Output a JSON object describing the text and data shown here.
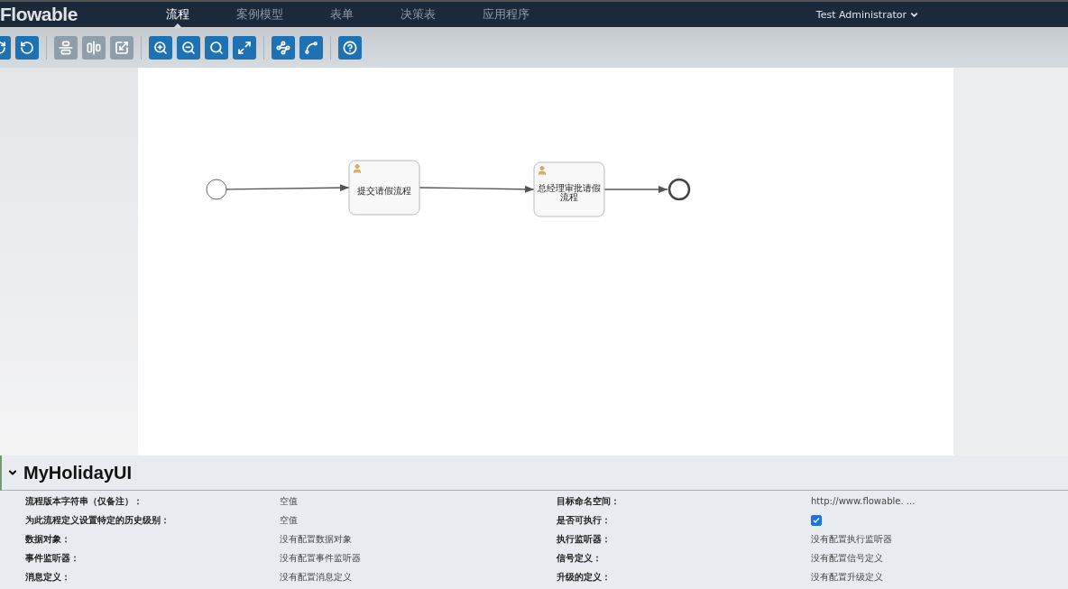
{
  "navbar": {
    "logo": "Flowable",
    "tabs": [
      {
        "label": "流程",
        "selected": true
      },
      {
        "label": "案例模型",
        "selected": false
      },
      {
        "label": "表单",
        "selected": false
      },
      {
        "label": "决策表",
        "selected": false
      },
      {
        "label": "应用程序",
        "selected": false
      }
    ],
    "user": "Test Administrator"
  },
  "toolbar": {
    "groups": [
      [
        {
          "kind": "redo",
          "disabled": false
        },
        {
          "kind": "undo",
          "disabled": false
        }
      ],
      [
        {
          "kind": "align_horizontal",
          "disabled": true
        },
        {
          "kind": "align_vertical",
          "disabled": true
        },
        {
          "kind": "same_size",
          "disabled": true
        }
      ],
      [
        {
          "kind": "zoom_in",
          "disabled": false
        },
        {
          "kind": "zoom_out",
          "disabled": false
        },
        {
          "kind": "zoom_actual",
          "disabled": false
        },
        {
          "kind": "zoom_fit",
          "disabled": false
        }
      ],
      [
        {
          "kind": "add_bendpoint",
          "disabled": false
        },
        {
          "kind": "remove_bendpoint",
          "disabled": false
        }
      ],
      [
        {
          "kind": "help",
          "disabled": false
        }
      ]
    ]
  },
  "diagram": {
    "nodes": [
      {
        "kind": "start"
      },
      {
        "kind": "user_task",
        "label": "提交请假流程"
      },
      {
        "kind": "user_task",
        "label": "总经理审批请假流程"
      },
      {
        "kind": "end"
      }
    ]
  },
  "properties_panel": {
    "title": "MyHolidayUI",
    "expanded": true,
    "properties": [
      {
        "label": "流程版本字符串（仅备注）：",
        "kind": "text",
        "value": "空值"
      },
      {
        "label": "目标命名空间：",
        "kind": "text",
        "value": "http://www.flowable. ..."
      },
      {
        "label": "为此流程定义设置特定的历史级别：",
        "kind": "text",
        "value": "空值"
      },
      {
        "label": "是否可执行：",
        "kind": "checkbox",
        "checked": true
      },
      {
        "label": "数据对象：",
        "kind": "text",
        "value": "没有配置数据对象"
      },
      {
        "label": "执行监听器：",
        "kind": "text",
        "value": "没有配置执行监听器"
      },
      {
        "label": "事件监听器：",
        "kind": "text",
        "value": "没有配置事件监听器"
      },
      {
        "label": "信号定义：",
        "kind": "text",
        "value": "没有配置信号定义"
      },
      {
        "label": "消息定义：",
        "kind": "text",
        "value": "没有配置消息定义"
      },
      {
        "label": "升级的定义：",
        "kind": "text",
        "value": "没有配置升级定义"
      }
    ]
  }
}
